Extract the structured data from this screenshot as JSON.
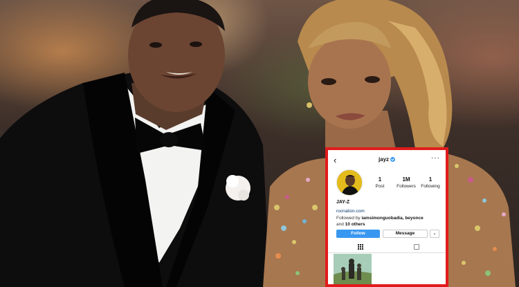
{
  "profile": {
    "username": "jayz",
    "display_name": "JAY-Z",
    "website": "rocnation.com",
    "followed_by_prefix": "Followed by ",
    "followed_by_names": "iamsimonguobadia, beyonce",
    "followed_by_and": "and ",
    "followed_by_others": "10 others"
  },
  "stats": [
    {
      "value": "1",
      "label": "Post"
    },
    {
      "value": "1M",
      "label": "Followers"
    },
    {
      "value": "1",
      "label": "Following"
    }
  ],
  "buttons": {
    "follow": "Follow",
    "message": "Message",
    "dropdown": "⌄"
  },
  "icons": {
    "back": "‹",
    "more": "···"
  },
  "colors": {
    "highlight_border": "#e11b1b",
    "follow_button": "#3897f0",
    "verified_badge": "#3897f0"
  }
}
